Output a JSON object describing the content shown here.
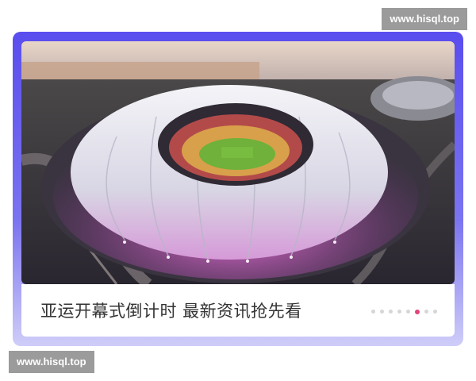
{
  "watermark": {
    "top_text": "www.hisql.top",
    "bottom_text": "www.hisql.top"
  },
  "banner": {
    "image_label": "stadium-aerial-photo",
    "caption": "亚运开幕式倒计时 最新资讯抢先看",
    "carousel": {
      "total": 8,
      "active_index": 5
    }
  },
  "colors": {
    "frame_top": "#5a4dee",
    "frame_bottom": "#cfcdf8",
    "active_dot": "#e0457b",
    "inactive_dot": "#d6d6d6",
    "caption_text": "#333333"
  }
}
